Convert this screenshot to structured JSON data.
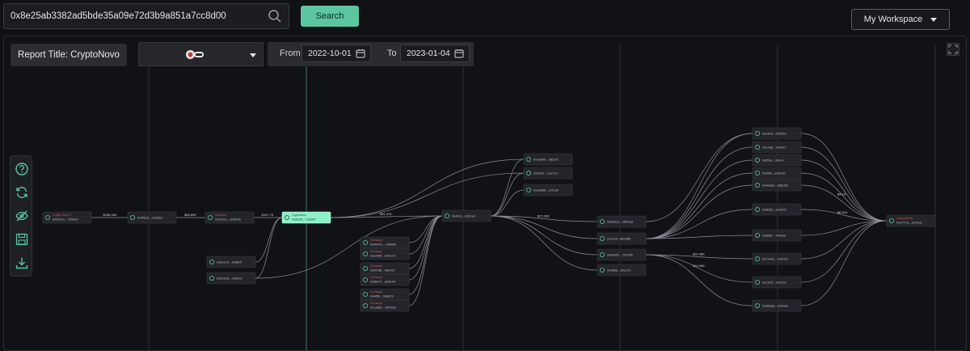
{
  "search": {
    "value": "0x8e25ab3382ad5bde35a09e72d3b9a851a7cc8d00",
    "button_label": "Search"
  },
  "workspace": {
    "label": "My Workspace"
  },
  "report": {
    "title": "Report Title: CryptoNovo"
  },
  "dates": {
    "from_label": "From",
    "from_value": "2022-10-01",
    "to_label": "To",
    "to_value": "2023-01-04"
  },
  "colors": {
    "accent": "#5cc6a0",
    "node_highlight": "#8ef0c8",
    "tag_red": "#d2525a"
  },
  "icons": [
    "search-icon",
    "help-icon",
    "refresh-icon",
    "hide-icon",
    "save-icon",
    "download-icon",
    "calendar-icon",
    "expand-icon"
  ],
  "nodes": [
    {
      "id": "n1",
      "tag": "Ledger Nano X",
      "label": "0x92ce1...7209c0"
    },
    {
      "id": "n2",
      "tag": "",
      "label": "0x4f5c6...1e2b60"
    },
    {
      "id": "n3",
      "tag": "Unknown",
      "label": "0x2a7c1...e03206"
    },
    {
      "id": "n4",
      "tag": "CryptoNovo",
      "label": "0x8e25...cc8d00"
    },
    {
      "id": "n5",
      "tag": "",
      "label": "0x6e1c4...16380f"
    },
    {
      "id": "n6",
      "tag": "",
      "label": "0xc0203...73d4c0"
    },
    {
      "id": "n7",
      "tag": "Exchange",
      "label": "0x4b97e...1908bb"
    },
    {
      "id": "n8",
      "tag": "Exchange",
      "label": "0xa1f90...e07ec5"
    },
    {
      "id": "n9",
      "tag": "Exchange",
      "label": "0x0f7d8...4be457"
    },
    {
      "id": "n10",
      "tag": "Exchange",
      "label": "0xf8e71...ab4244"
    },
    {
      "id": "n11",
      "tag": "Exchange",
      "label": "0x46f9...bb6629"
    },
    {
      "id": "n12",
      "tag": "Exchange",
      "label": "0x1a5b2...55789e"
    },
    {
      "id": "n13",
      "tag": "",
      "label": "0x40cc...c0d1e0"
    },
    {
      "id": "n14",
      "tag": "",
      "label": "0xd3a40...d82ef1"
    },
    {
      "id": "n15",
      "tag": "",
      "label": "0x0002...1ce713"
    },
    {
      "id": "n16",
      "tag": "",
      "label": "0xe6b60...37f1d0"
    },
    {
      "id": "n17",
      "tag": "",
      "label": "0x8b513...2581e8"
    },
    {
      "id": "n18",
      "tag": "",
      "label": "0xc1c8...8bc48b"
    },
    {
      "id": "n19",
      "tag": "",
      "label": "0x45a51...741186"
    },
    {
      "id": "n20",
      "tag": "",
      "label": "0xd86e...2bc171"
    },
    {
      "id": "n21",
      "tag": "",
      "label": "0xe833...87bd51"
    },
    {
      "id": "n22",
      "tag": "",
      "label": "0xe7a8...7ee0e7"
    },
    {
      "id": "n23",
      "tag": "",
      "label": "0xf60a...d0ec4"
    },
    {
      "id": "n24",
      "tag": "",
      "label": "0x9f90...e00e0b"
    },
    {
      "id": "n25",
      "tag": "",
      "label": "0x4bae0...83bd16"
    },
    {
      "id": "n26",
      "tag": "",
      "label": "0x8b52...ac4376"
    },
    {
      "id": "n27",
      "tag": "",
      "label": "0x8687...4418af"
    },
    {
      "id": "n28",
      "tag": "",
      "label": "0x744cb...0c8720"
    },
    {
      "id": "n29",
      "tag": "",
      "label": "0x1216...4c2219"
    },
    {
      "id": "n30",
      "tag": "",
      "label": "0x8518a...a7bae0"
    },
    {
      "id": "n31",
      "tag": "ChangeNOW",
      "label": "0x0777a...a7c4a1"
    }
  ],
  "edge_labels": [
    "$158.46K",
    "$68.89K",
    "$321.7K",
    "$81.47K",
    "$72.03K",
    "$10.48K",
    "$10.28K",
    "$4.1K",
    "$6.61K"
  ]
}
